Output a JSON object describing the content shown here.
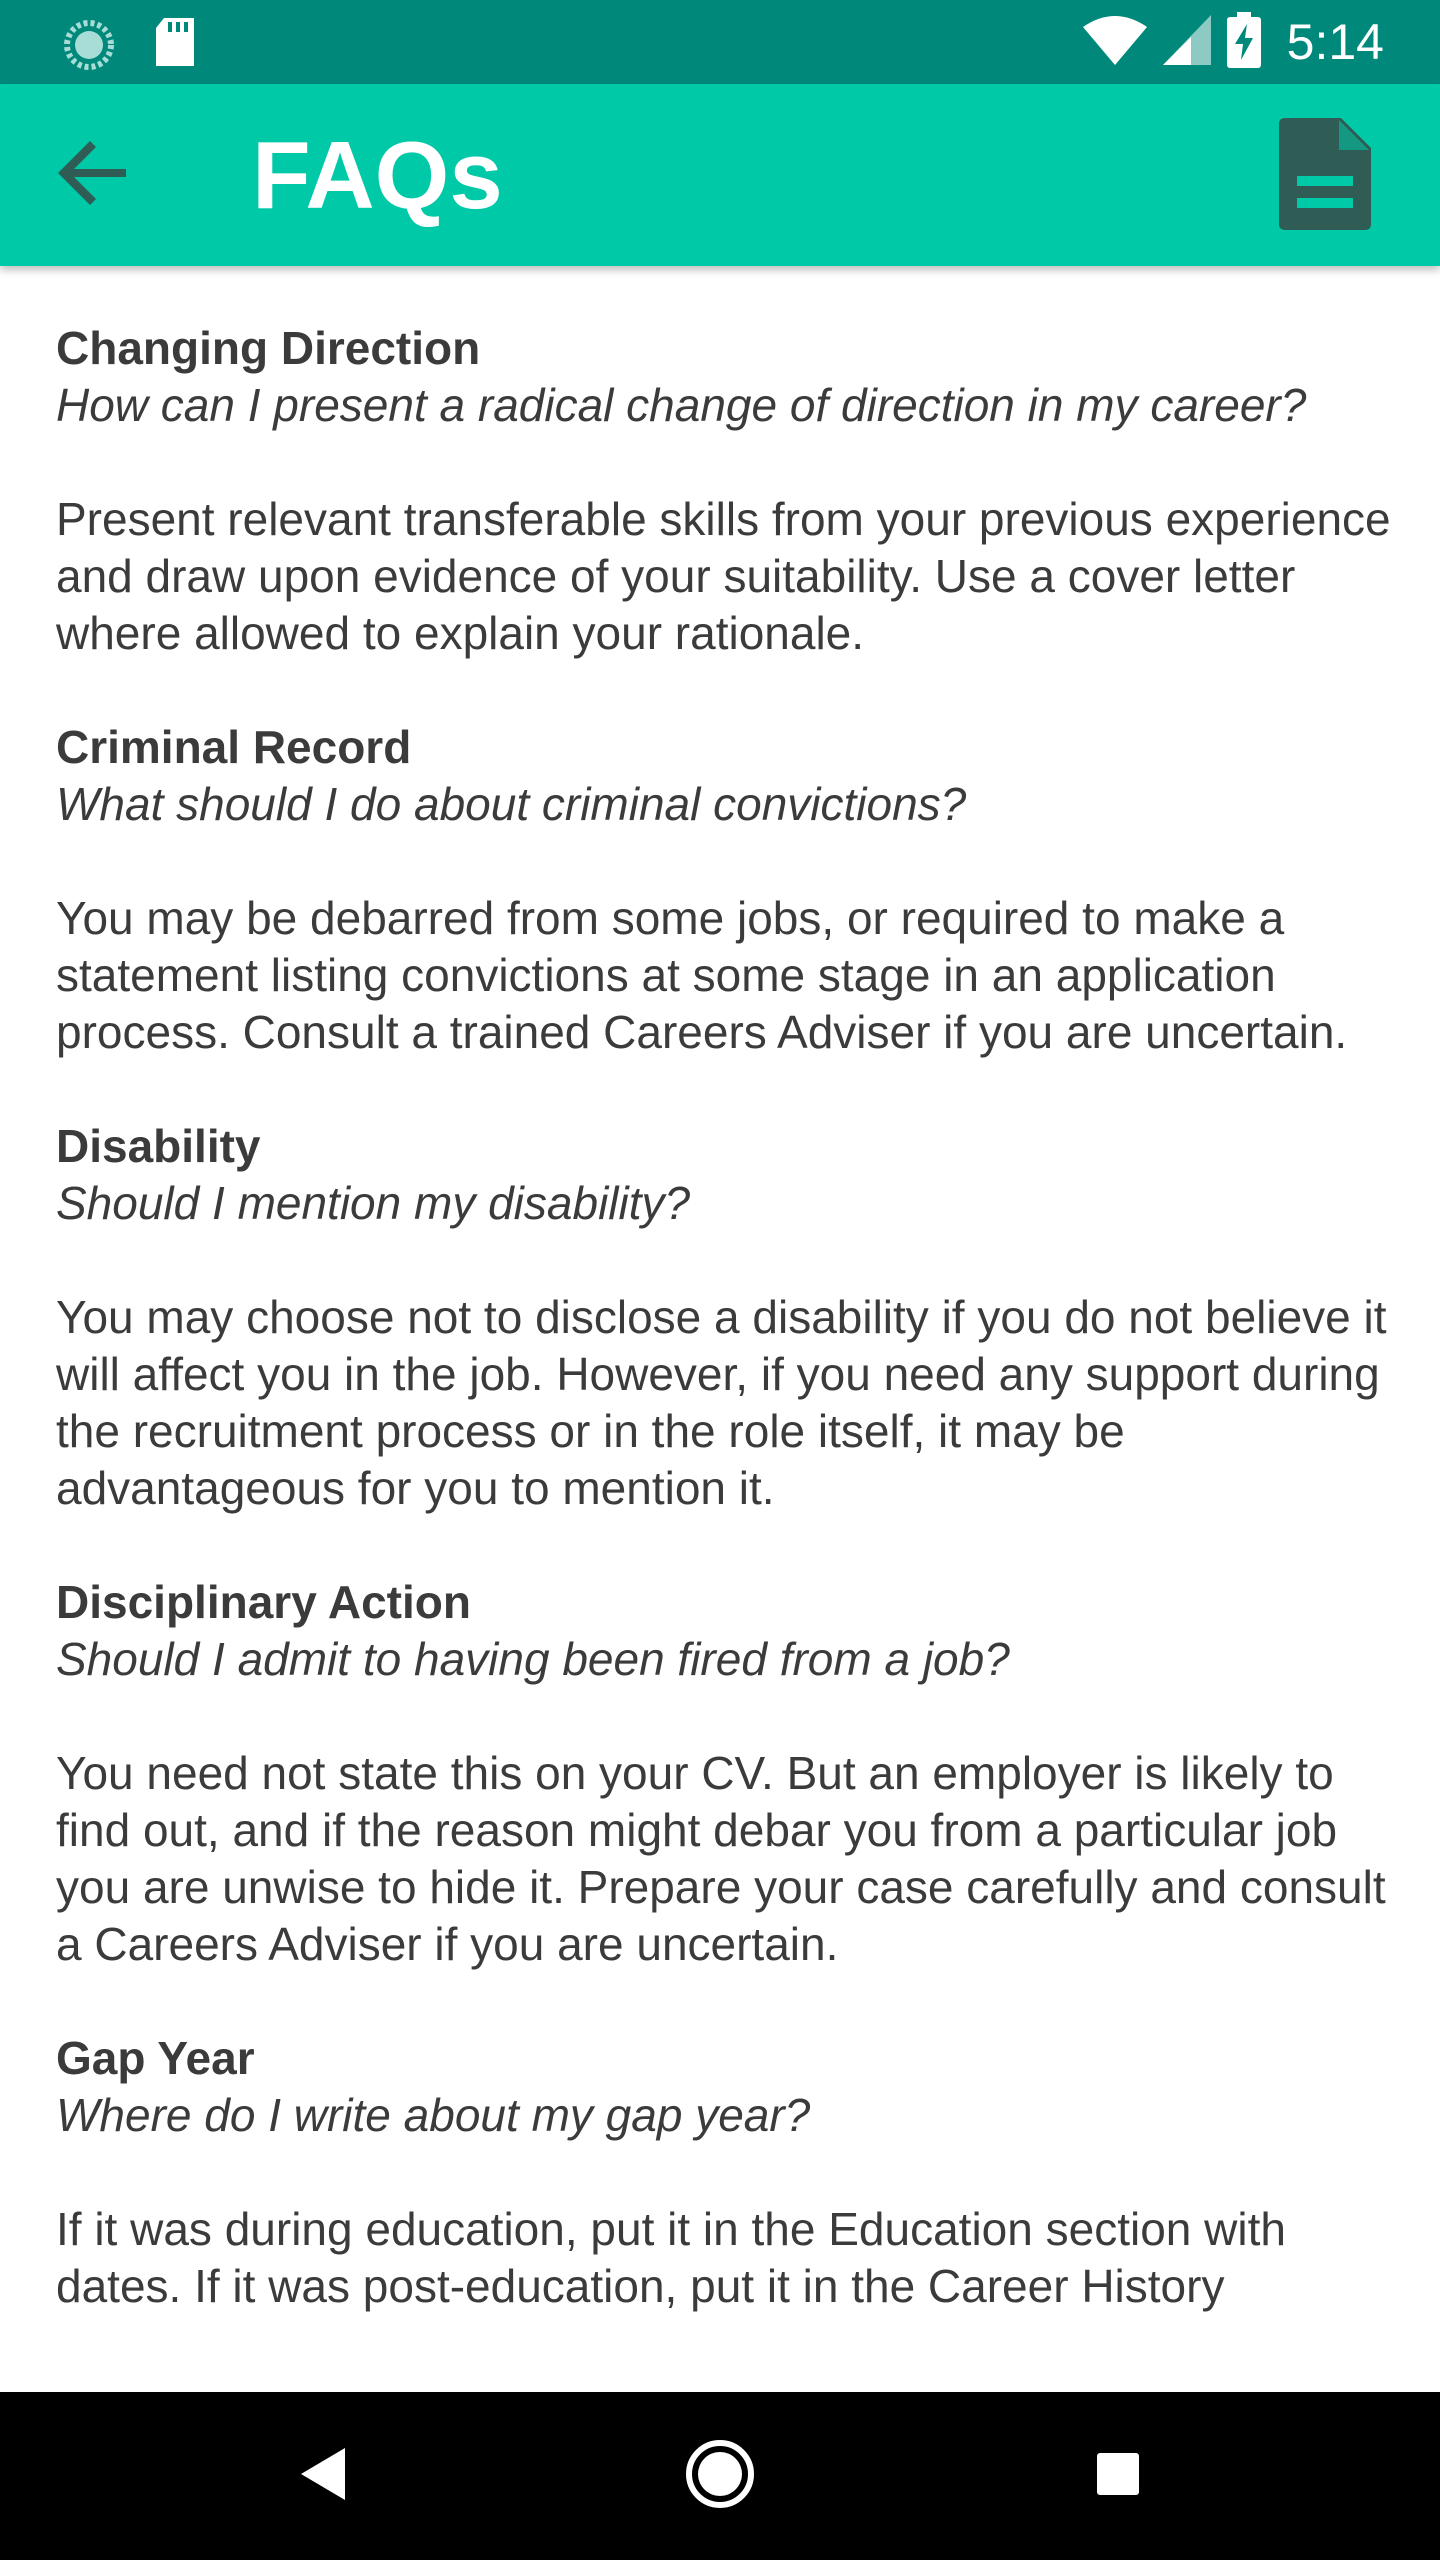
{
  "status_bar": {
    "time": "5:14",
    "icons": [
      "sync-icon",
      "sd-card-icon",
      "wifi-icon",
      "cell-signal-icon",
      "battery-charging-icon"
    ]
  },
  "app_bar": {
    "title": "FAQs",
    "back_icon": "arrow-back-icon",
    "action_icon": "document-icon",
    "background": "#00c9a7"
  },
  "faqs": [
    {
      "title": "Changing Direction",
      "question": "How can I present a radical change of direction in my career?",
      "answer": "Present relevant transferable skills from your previous experience and draw upon evidence of your suitability. Use a cover letter where allowed to explain your rationale."
    },
    {
      "title": "Criminal Record",
      "question": "What should I do about criminal convictions?",
      "answer": "You may be debarred from some jobs, or required to make a statement listing convictions at some stage in an application process. Consult a trained Careers Adviser if you are uncertain."
    },
    {
      "title": "Disability",
      "question": "Should I mention my disability?",
      "answer": "You may choose not to disclose a disability if you do not believe it will affect you in the job. However, if you need any support during the recruitment process or in the role itself, it may be advantageous for you to mention it."
    },
    {
      "title": "Disciplinary Action",
      "question": "Should I admit to having been fired from a job?",
      "answer": "You need not state this on your CV. But an employer is likely to find out, and if the reason might debar you from a particular job you are unwise to hide it. Prepare your case carefully and consult a Careers Adviser if you are uncertain."
    },
    {
      "title": "Gap Year",
      "question": "Where do I write about my gap year?",
      "answer": "If it was during education, put it in the Education section with dates. If it was post-education, put it in the Career History"
    }
  ],
  "nav_bar": {
    "icons": [
      "nav-back-icon",
      "nav-home-icon",
      "nav-recents-icon"
    ]
  }
}
